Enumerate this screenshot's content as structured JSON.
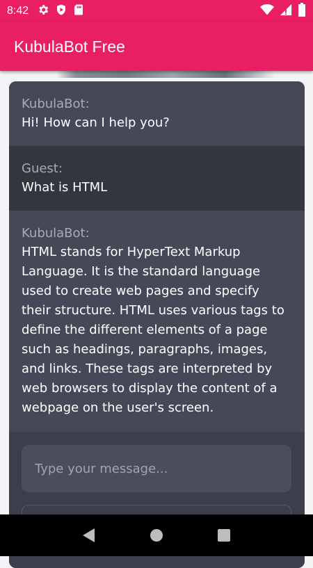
{
  "status_bar": {
    "time": "8:42",
    "left_icons": [
      "gear-icon",
      "shield-play-icon",
      "sd-card-icon"
    ],
    "right_icons": [
      "wifi-icon",
      "signal-icon",
      "battery-icon"
    ]
  },
  "app_bar": {
    "title": "KubulaBot Free",
    "color": "#e91e63"
  },
  "chat": {
    "messages": [
      {
        "sender": "KubulaBot:",
        "text": "Hi! How can I help you?"
      },
      {
        "sender": "Guest:",
        "text": "What is HTML"
      },
      {
        "sender": "KubulaBot:",
        "text": "HTML stands for HyperText Markup Language. It is the standard language used to create web pages and specify their structure. HTML uses various tags to define the different elements of a page such as headings, paragraphs, images, and links. These tags are interpreted by web browsers to display the content of a webpage on the user's screen."
      }
    ]
  },
  "input": {
    "placeholder": "Type your message..."
  },
  "nav_bar": {
    "buttons": [
      "back-icon",
      "home-icon",
      "recents-icon"
    ]
  }
}
